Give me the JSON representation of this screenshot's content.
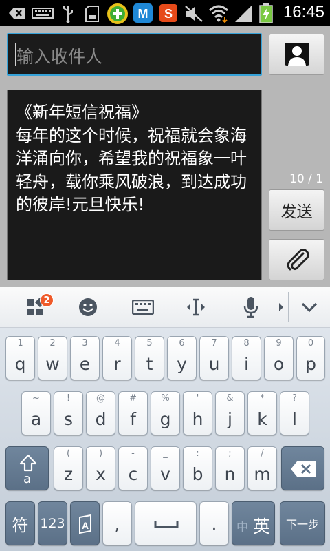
{
  "status_bar": {
    "time": "16:45",
    "icons": [
      "back-icon",
      "keyboard-icon",
      "usb-icon",
      "sd-card-icon",
      "security-app-icon",
      "m-app-icon",
      "s-app-icon",
      "mute-icon",
      "wifi-icon",
      "signal-icon",
      "battery-charging-icon"
    ]
  },
  "compose": {
    "recipient_placeholder": "输入收件人",
    "message_text": "《新年短信祝福》\n每年的这个时候，祝福就会象海洋涌向你，希望我的祝福象一叶轻舟，载你乘风破浪，到达成功的彼岸!元旦快乐!",
    "counter": "10 / 1",
    "send_label": "发送",
    "contact_icon": "contact-icon",
    "attach_icon": "paperclip-icon"
  },
  "keyboard_toolbar": {
    "badge_count": "2",
    "items": [
      "apps-icon",
      "emoji-icon",
      "keyboard-switch-icon",
      "cursor-icon",
      "microphone-icon",
      "more-arrow-icon",
      "hide-keyboard-icon"
    ]
  },
  "keyboard": {
    "row1": [
      {
        "hint": "1",
        "key": "q"
      },
      {
        "hint": "2",
        "key": "w"
      },
      {
        "hint": "3",
        "key": "e"
      },
      {
        "hint": "4",
        "key": "r"
      },
      {
        "hint": "5",
        "key": "t"
      },
      {
        "hint": "6",
        "key": "y"
      },
      {
        "hint": "7",
        "key": "u"
      },
      {
        "hint": "8",
        "key": "i"
      },
      {
        "hint": "9",
        "key": "o"
      },
      {
        "hint": "0",
        "key": "p"
      }
    ],
    "row2": [
      {
        "hint": "~",
        "key": "a"
      },
      {
        "hint": "!",
        "key": "s"
      },
      {
        "hint": "@",
        "key": "d"
      },
      {
        "hint": "#",
        "key": "f"
      },
      {
        "hint": "%",
        "key": "g"
      },
      {
        "hint": "'",
        "key": "h"
      },
      {
        "hint": "&",
        "key": "j"
      },
      {
        "hint": "*",
        "key": "k"
      },
      {
        "hint": "?",
        "key": "l"
      }
    ],
    "row3": [
      {
        "hint": "(",
        "key": "z"
      },
      {
        "hint": ")",
        "key": "x"
      },
      {
        "hint": "-",
        "key": "c"
      },
      {
        "hint": "_",
        "key": "v"
      },
      {
        "hint": ":",
        "key": "b"
      },
      {
        "hint": ";",
        "key": "n"
      },
      {
        "hint": "/",
        "key": "m"
      }
    ],
    "shift_label": "a",
    "symbol_label": "符",
    "number_label": "123",
    "comma_label": ",",
    "period_label": ".",
    "lang_label_inactive": "中",
    "lang_label_active": "英",
    "next_label": "下一步"
  }
}
